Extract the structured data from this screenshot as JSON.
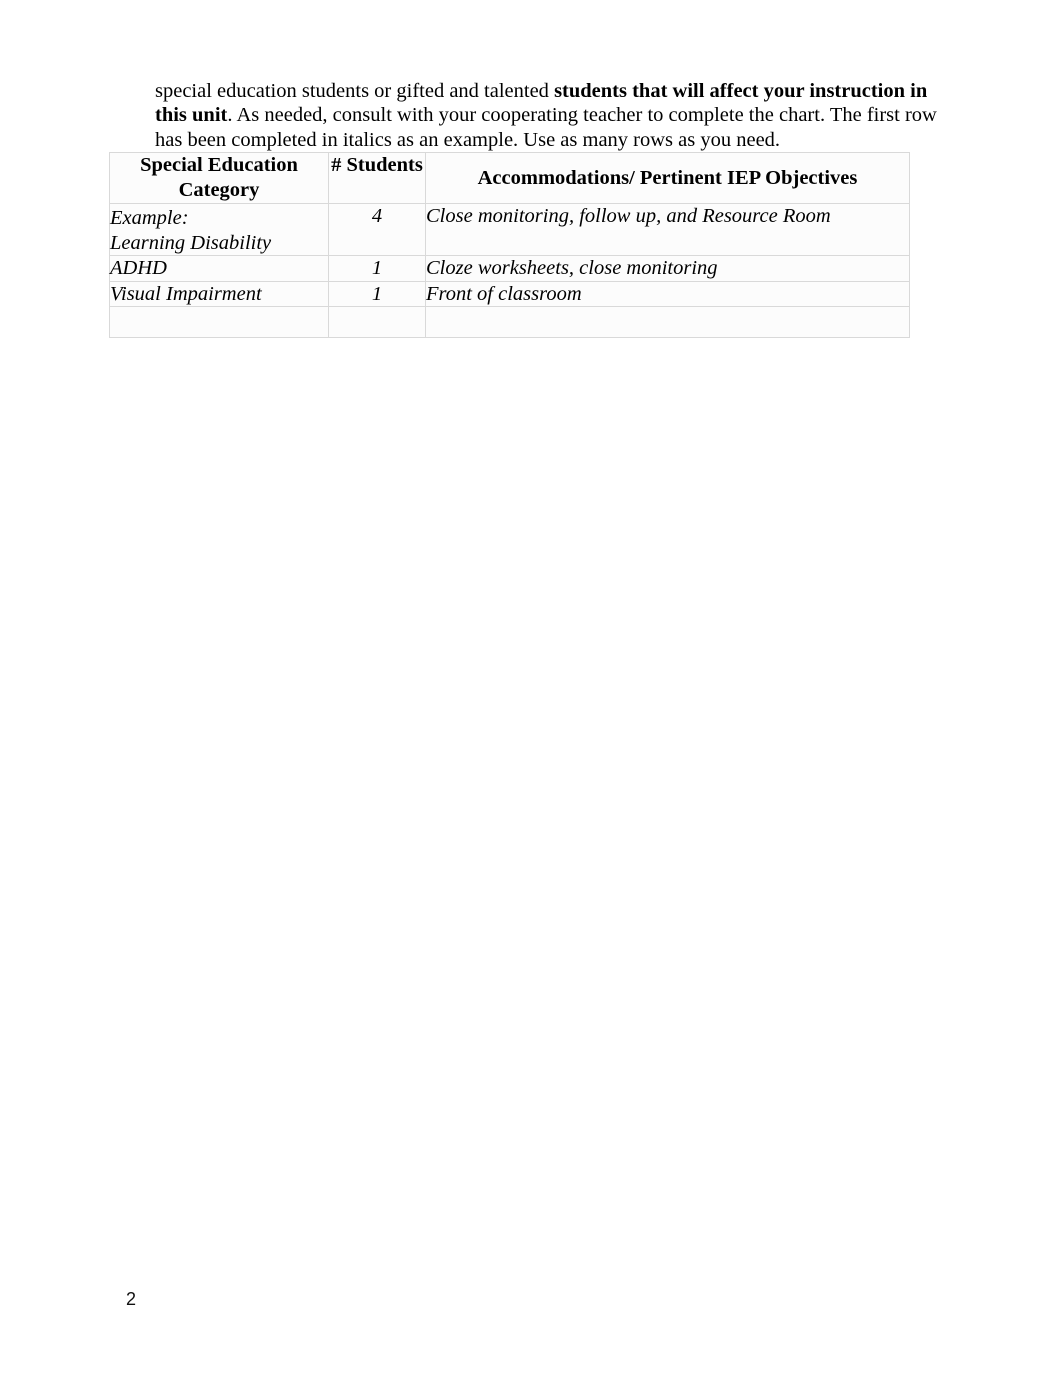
{
  "document": {
    "page_number": "2",
    "paragraph": {
      "segments": [
        {
          "text": "special education students or gifted and talented ",
          "bold": false
        },
        {
          "text": "students that will affect your instruction in this unit",
          "bold": true
        },
        {
          "text": ". As needed, consult with your cooperating teacher to complete the chart. The first row has been completed in italics as an example. Use as many rows as you need.",
          "bold": false
        }
      ],
      "plain_text": "special education students or gifted and talented students that will affect your instruction in this unit. As needed, consult with your cooperating teacher to complete the chart. The first row has been completed in italics as an example. Use as many rows as you need."
    },
    "table": {
      "headers": [
        "Special Education Category",
        "# Students",
        "Accommodations/ Pertinent IEP Objectives"
      ],
      "rows": [
        {
          "category": "Example:\nLearning Disability",
          "students": "4",
          "accommodations": "Close monitoring, follow up, and Resource Room"
        },
        {
          "category": "ADHD",
          "students": "1",
          "accommodations": "Cloze worksheets, close monitoring"
        },
        {
          "category": "Visual Impairment",
          "students": "1",
          "accommodations": "Front of classroom"
        },
        {
          "category": "",
          "students": "",
          "accommodations": ""
        }
      ]
    },
    "colors": {
      "page_background": "#ffffff",
      "text": "#000000",
      "table_border": "#d9d9d9",
      "table_cell_background": "#fcfcfc"
    }
  }
}
